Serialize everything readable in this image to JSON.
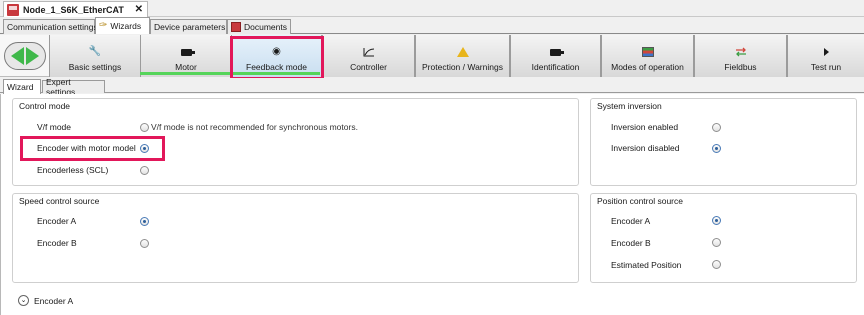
{
  "document": {
    "title": "Node_1_S6K_EtherCAT",
    "close_glyph": "✕",
    "icon": "drive-node-icon"
  },
  "top_tabs": [
    {
      "label": "Communication settings"
    },
    {
      "label": "Wizards",
      "icon": "key-icon"
    },
    {
      "label": "Device parameters"
    },
    {
      "label": "Documents",
      "icon": "documents-icon"
    }
  ],
  "toolbar": {
    "buttons": [
      {
        "label": "Basic settings",
        "icon": "wrench-icon"
      },
      {
        "label": "Motor",
        "icon": "motor-icon"
      },
      {
        "label": "Feedback mode",
        "icon": "encoder-icon"
      },
      {
        "label": "Controller",
        "icon": "controller-curve-icon"
      },
      {
        "label": "Protection / Warnings",
        "icon": "warning-icon"
      },
      {
        "label": "Identification",
        "icon": "motor-icon"
      },
      {
        "label": "Modes of operation",
        "icon": "modes-icon"
      },
      {
        "label": "Fieldbus",
        "icon": "exchange-arrows-icon"
      },
      {
        "label": "Test run",
        "icon": "play-icon"
      }
    ],
    "active": "Feedback mode",
    "accent_color": "#55d45a",
    "highlight_color": "#e2175a"
  },
  "sub_tabs": [
    {
      "label": "Wizard"
    },
    {
      "label": "Expert settings"
    }
  ],
  "control_mode": {
    "title": "Control mode",
    "options": [
      {
        "label": "V/f mode",
        "checked": false,
        "note": "V/f mode is not recommended for synchronous motors."
      },
      {
        "label": "Encoder with motor model",
        "checked": true
      },
      {
        "label": "Encoderless (SCL)",
        "checked": false
      }
    ]
  },
  "system_inversion": {
    "title": "System inversion",
    "options": [
      {
        "label": "Inversion enabled",
        "checked": false
      },
      {
        "label": "Inversion disabled",
        "checked": true
      }
    ]
  },
  "speed_control_source": {
    "title": "Speed control source",
    "options": [
      {
        "label": "Encoder A",
        "checked": true
      },
      {
        "label": "Encoder B",
        "checked": false
      }
    ]
  },
  "position_control_source": {
    "title": "Position control source",
    "options": [
      {
        "label": "Encoder A",
        "checked": true
      },
      {
        "label": "Encoder B",
        "checked": false
      },
      {
        "label": "Estimated Position",
        "checked": false
      }
    ]
  },
  "encoder_expander": {
    "label": "Encoder A",
    "chevron": "⌄"
  }
}
